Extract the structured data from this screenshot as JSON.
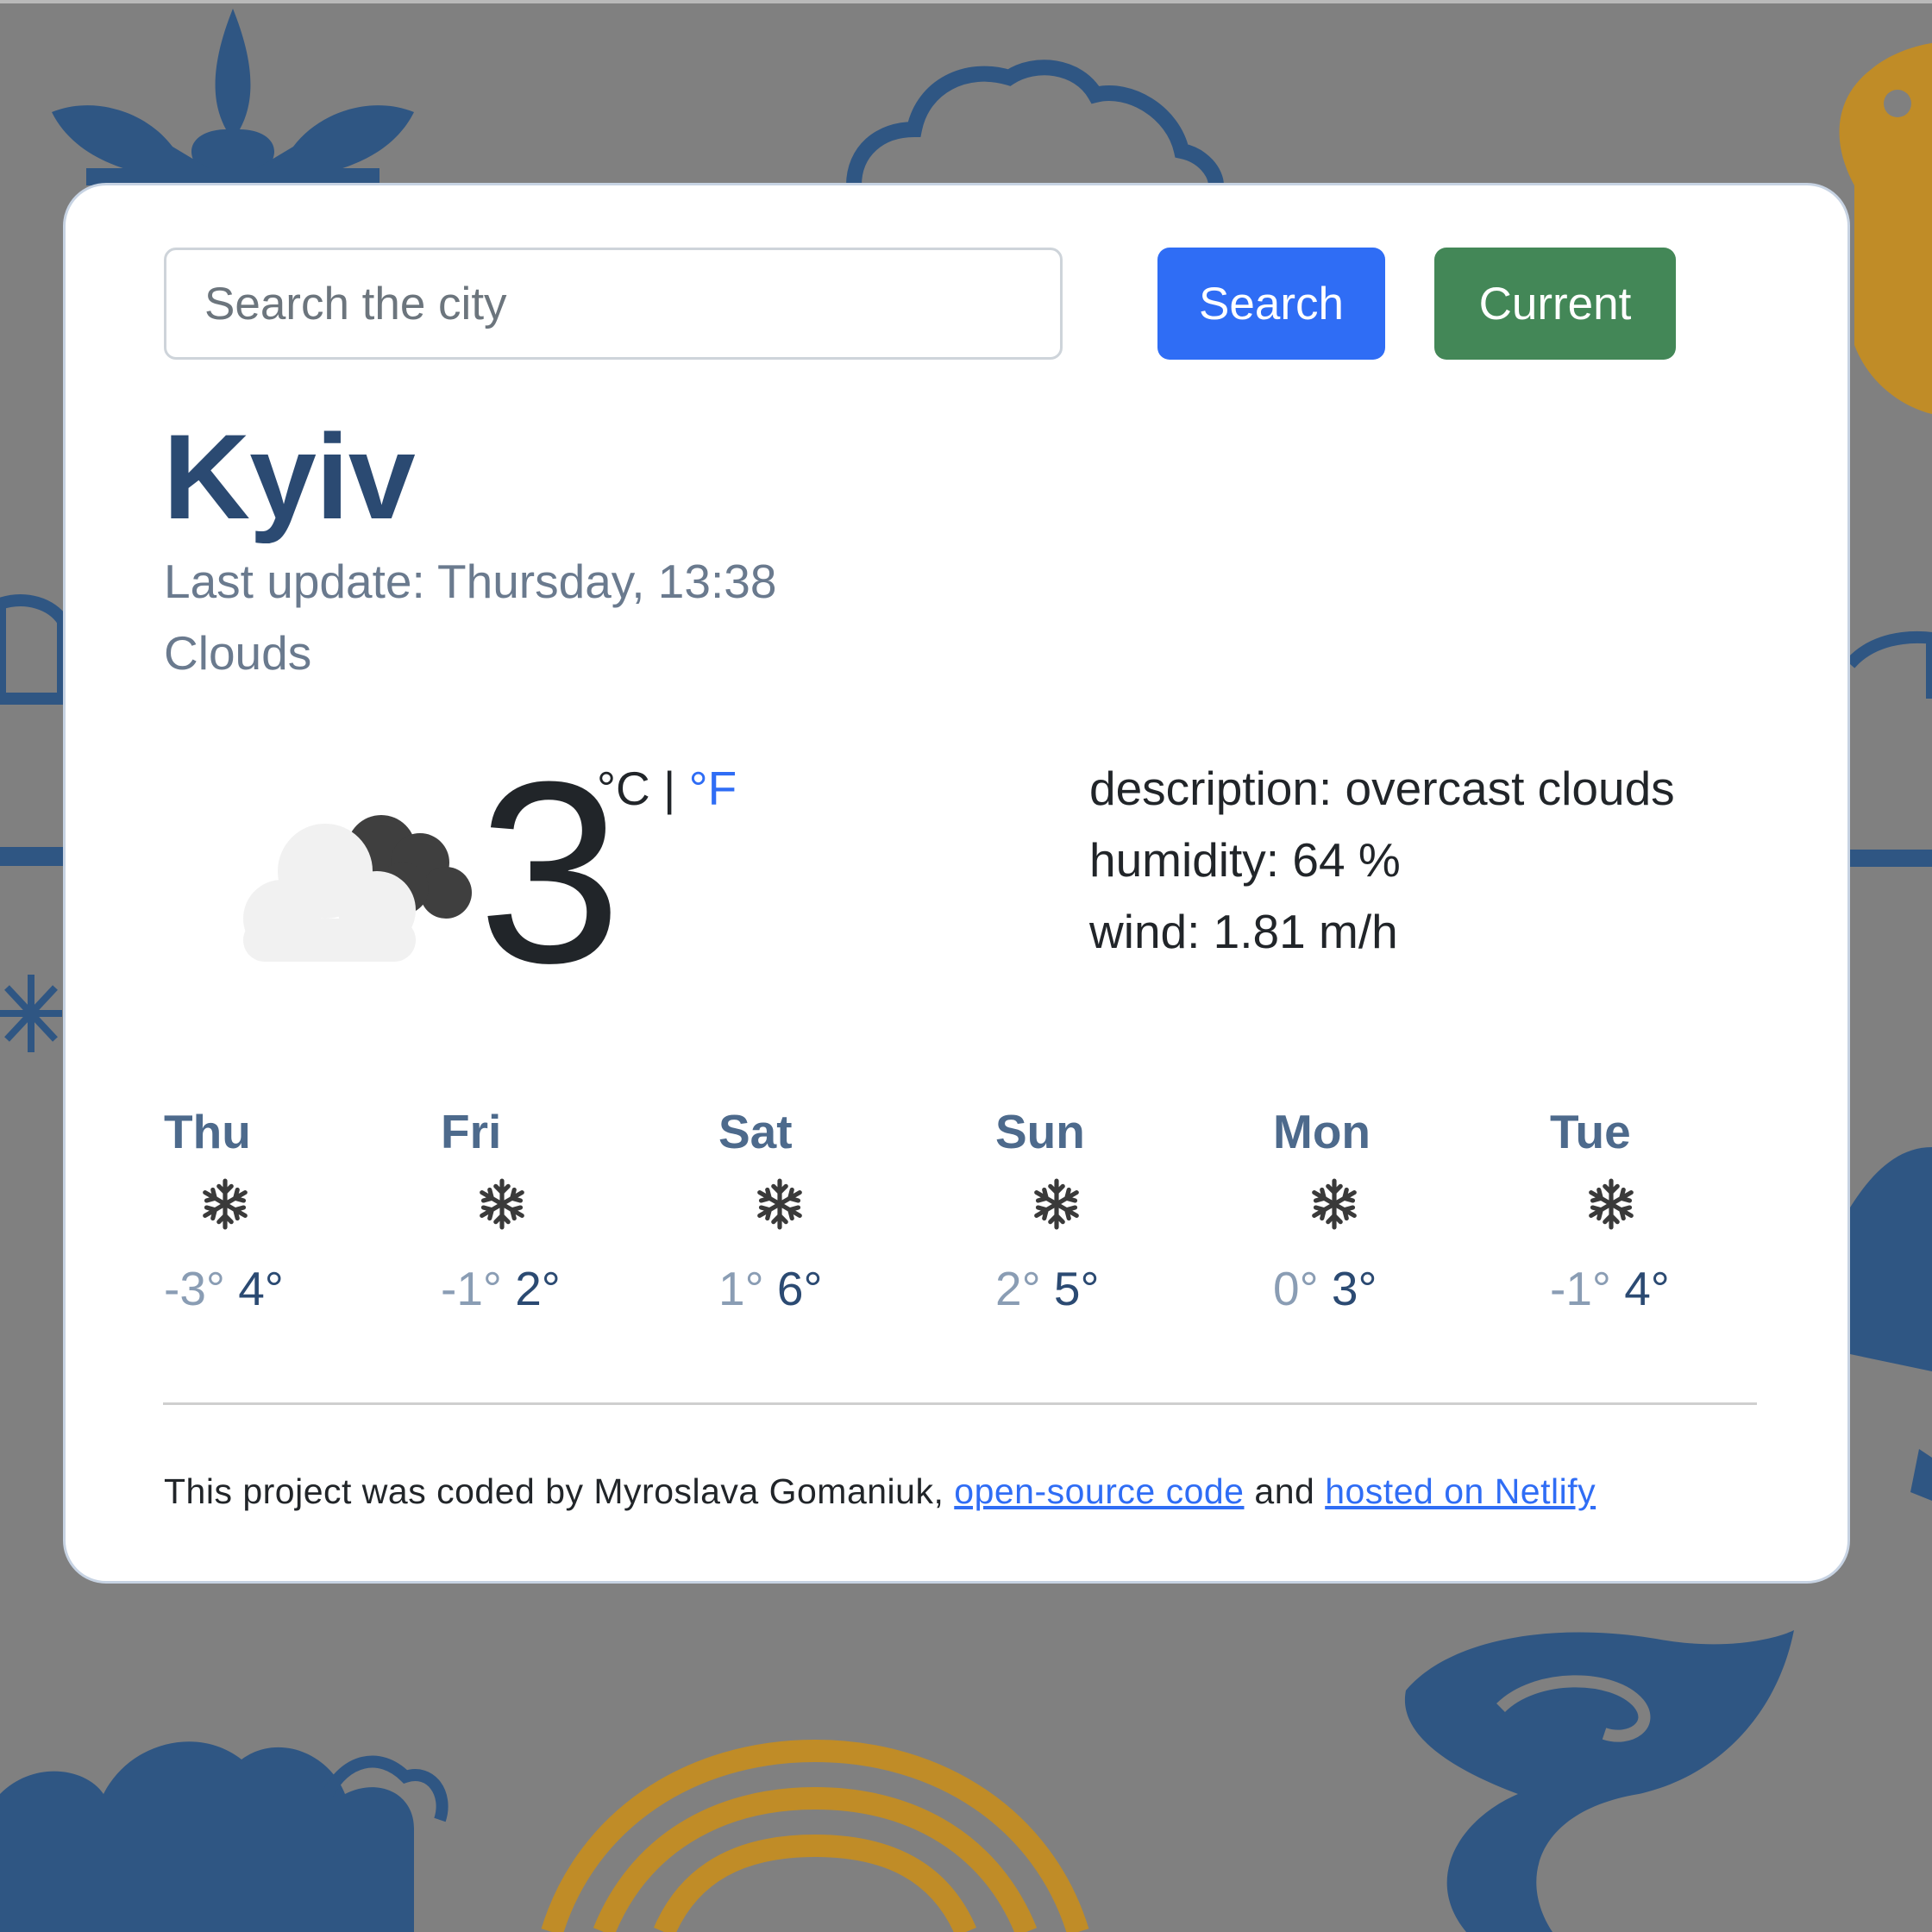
{
  "search": {
    "placeholder": "Search the city"
  },
  "buttons": {
    "search_label": "Search",
    "current_label": "Current"
  },
  "city": "Kyiv",
  "last_update": "Last update: Thursday, 13:38",
  "condition": "Clouds",
  "current": {
    "temperature": "3",
    "unit_celsius": "°C",
    "unit_separator": " | ",
    "unit_fahrenheit": "°F",
    "icon": "partly-cloudy-icon"
  },
  "details": {
    "description": "description: overcast clouds",
    "humidity": "humidity: 64 %",
    "wind": "wind: 1.81 m/h"
  },
  "forecast": [
    {
      "day": "Thu",
      "min": "-3°",
      "max": "4°",
      "icon": "snowflake-icon"
    },
    {
      "day": "Fri",
      "min": "-1°",
      "max": "2°",
      "icon": "snowflake-icon"
    },
    {
      "day": "Sat",
      "min": "1°",
      "max": "6°",
      "icon": "snowflake-icon"
    },
    {
      "day": "Sun",
      "min": "2°",
      "max": "5°",
      "icon": "snowflake-icon"
    },
    {
      "day": "Mon",
      "min": "0°",
      "max": "3°",
      "icon": "snowflake-icon"
    },
    {
      "day": "Tue",
      "min": "-1°",
      "max": "4°",
      "icon": "snowflake-icon"
    }
  ],
  "footer": {
    "text_before": "This project was coded by Myroslava Gomaniuk, ",
    "link_code": "open-source code",
    "text_middle": " and ",
    "link_hosting": "hosted on Netlify"
  },
  "colors": {
    "background": "#808080",
    "accent_blue": "#2f6df5",
    "accent_green": "#438757",
    "heading": "#2b4a72",
    "ornament_blue": "#2f5683",
    "ornament_gold": "#c08c27"
  }
}
